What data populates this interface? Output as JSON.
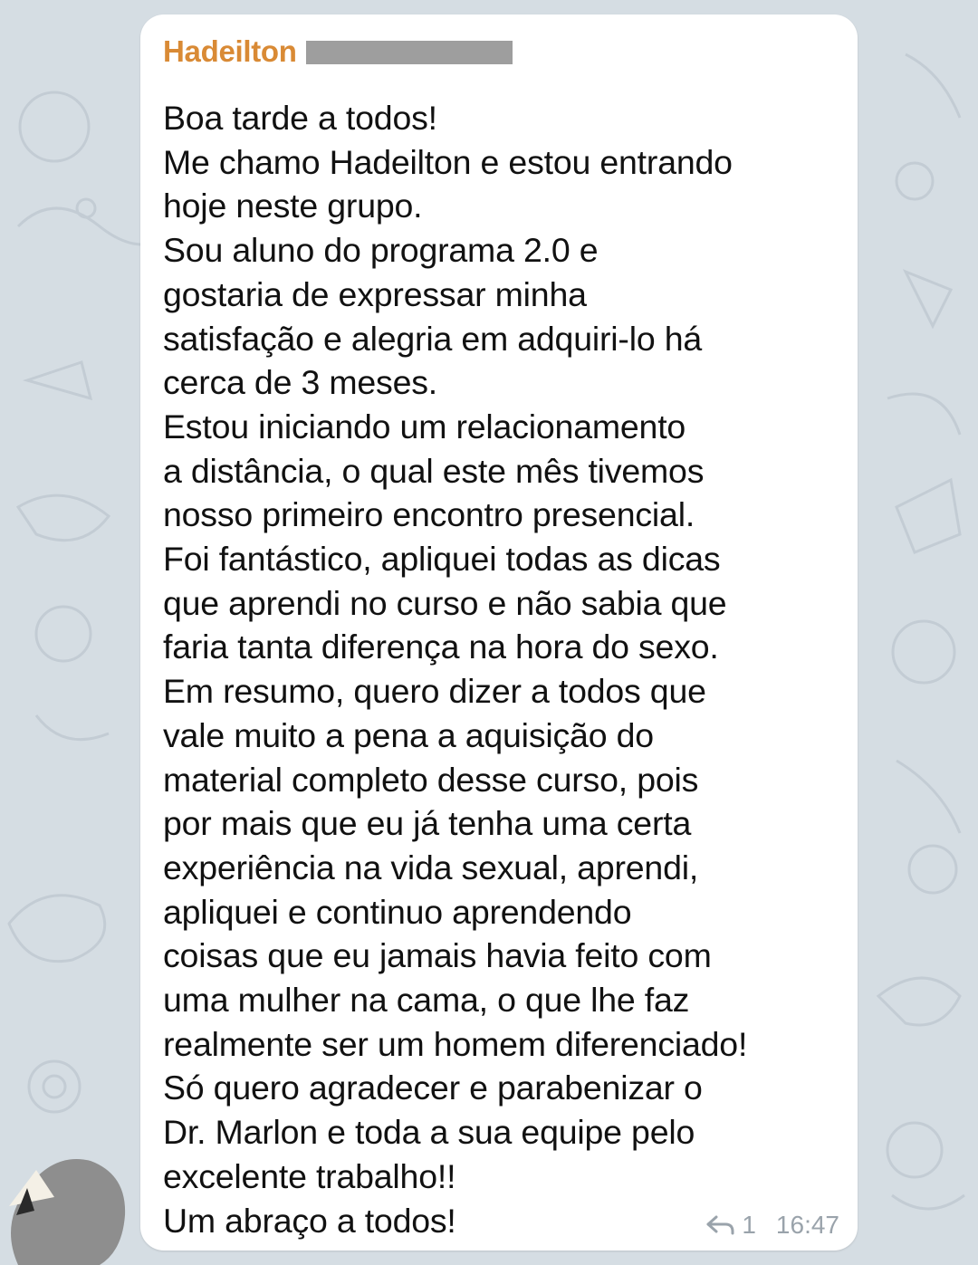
{
  "message": {
    "sender": "Hadeilton",
    "lines": [
      "Boa tarde a todos!",
      "Me chamo Hadeilton e estou entrando",
      "hoje neste grupo.",
      "Sou aluno do programa 2.0 e",
      "gostaria de expressar minha",
      "satisfação e alegria em adquiri-lo há",
      "cerca de 3 meses.",
      "Estou iniciando um relacionamento",
      "a distância, o qual este mês tivemos",
      "nosso primeiro encontro presencial.",
      "Foi fantástico, apliquei todas as dicas",
      "que aprendi no curso e não sabia que",
      "faria tanta diferença na hora do sexo.",
      "Em resumo, quero dizer a todos que",
      "vale muito a pena a aquisição do",
      "material completo desse curso, pois",
      "por mais que eu já tenha uma certa",
      "experiência na vida sexual, aprendi,",
      "apliquei e continuo aprendendo",
      "coisas que eu jamais havia feito com",
      "uma mulher na cama, o que lhe faz",
      "realmente ser um homem diferenciado!",
      "Só quero agradecer e parabenizar o",
      "Dr. Marlon e toda a sua equipe pelo",
      "excelente trabalho!!",
      "Um abraço a todos!"
    ],
    "reply_count": "1",
    "time": "16:47"
  },
  "colors": {
    "sender_name": "#d98a35",
    "background": "#d5dde3",
    "bubble": "#ffffff",
    "meta": "#9aa3ab"
  },
  "icons": {
    "reply": "reply-arrow-icon"
  }
}
